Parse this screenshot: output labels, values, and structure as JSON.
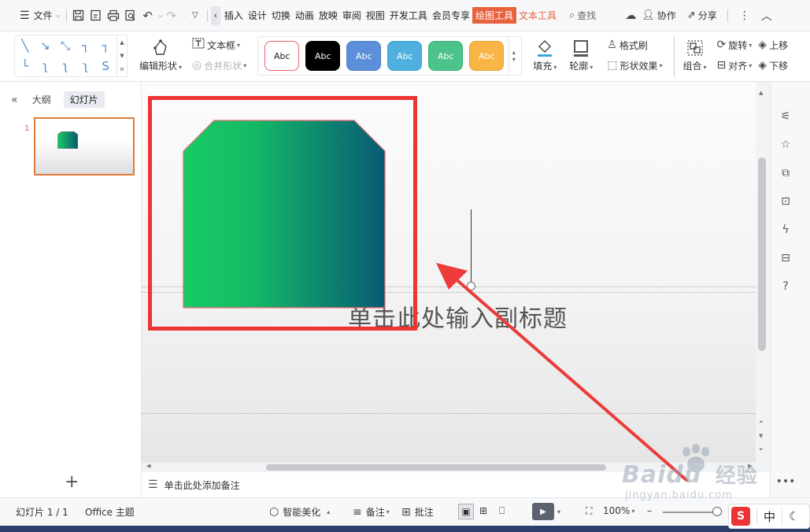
{
  "menubar": {
    "file_label": "文件",
    "tabs": [
      {
        "label": "插入",
        "state": "normal"
      },
      {
        "label": "设计",
        "state": "normal"
      },
      {
        "label": "切换",
        "state": "normal"
      },
      {
        "label": "动画",
        "state": "normal"
      },
      {
        "label": "放映",
        "state": "normal"
      },
      {
        "label": "审阅",
        "state": "normal"
      },
      {
        "label": "视图",
        "state": "normal"
      },
      {
        "label": "开发工具",
        "state": "normal"
      },
      {
        "label": "会员专享",
        "state": "normal"
      },
      {
        "label": "绘图工具",
        "state": "active"
      },
      {
        "label": "文本工具",
        "state": "orange"
      }
    ],
    "search_label": "查找",
    "collab_label": "协作",
    "share_label": "分享"
  },
  "ribbon": {
    "edit_shape": "编辑形状",
    "text_box": "文本框",
    "merge_shape": "合并形状",
    "styles": [
      {
        "label": "Abc",
        "bg": "#ffffff",
        "border": "#e8626a",
        "color": "#222222"
      },
      {
        "label": "Abc",
        "bg": "#000000",
        "border": "#000000",
        "color": "#ffffff"
      },
      {
        "label": "Abc",
        "bg": "#5b8fd9",
        "border": "#4a7ec8",
        "color": "#ffffff"
      },
      {
        "label": "Abc",
        "bg": "#4fb0e0",
        "border": "#3ea0d0",
        "color": "#ffffff"
      },
      {
        "label": "Abc",
        "bg": "#4cc38a",
        "border": "#3bb37a",
        "color": "#ffffff"
      },
      {
        "label": "Abc",
        "bg": "#f8b445",
        "border": "#e8a435",
        "color": "#ffffff"
      }
    ],
    "fill": "填充",
    "outline": "轮廓",
    "format_painter": "格式刷",
    "shape_effects": "形状效果",
    "group": "组合",
    "rotate": "旋转",
    "align": "对齐",
    "bring_forward": "上移",
    "send_backward": "下移"
  },
  "left_panel": {
    "tab_outline": "大纲",
    "tab_slides": "幻灯片",
    "slide_number": "1"
  },
  "canvas": {
    "subtitle_placeholder": "单击此处输入副标题",
    "shape_gradient_start": "#17cc64",
    "shape_gradient_end": "#075a74",
    "shape_outline": "#e86a70",
    "highlight_color": "#ee3333"
  },
  "notes": {
    "placeholder": "单击此处添加备注"
  },
  "statusbar": {
    "slide_counter": "幻灯片 1 / 1",
    "theme": "Office 主题",
    "smart_beautify": "智能美化",
    "notes": "备注",
    "comments": "批注",
    "zoom": "100%"
  },
  "watermark": {
    "brand": "Baidu",
    "brand_cn": "经验",
    "url": "jingyan.baidu.com"
  },
  "ime": {
    "logo": "S",
    "lang": "中"
  }
}
